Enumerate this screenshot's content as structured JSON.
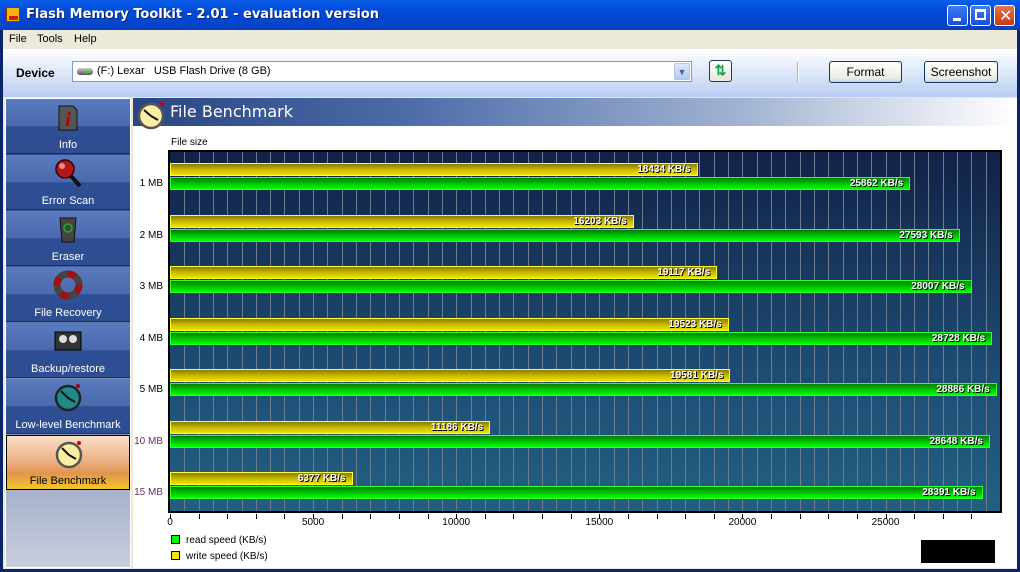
{
  "window": {
    "title": "Flash Memory Toolkit - 2.01 - evaluation version"
  },
  "menu": [
    "File",
    "Tools",
    "Help"
  ],
  "toolbar": {
    "device_label": "Device",
    "device_value": "(F:) Lexar   USB Flash Drive (8 GB)",
    "format_label": "Format",
    "screenshot_label": "Screenshot"
  },
  "sidebar": {
    "items": [
      {
        "label": "Info",
        "icon": "info-icon"
      },
      {
        "label": "Error Scan",
        "icon": "magnifier-icon"
      },
      {
        "label": "Eraser",
        "icon": "trash-icon"
      },
      {
        "label": "File Recovery",
        "icon": "lifebuoy-icon"
      },
      {
        "label": "Backup/restore",
        "icon": "tape-icon"
      },
      {
        "label": "Low-level Benchmark",
        "icon": "stopwatch-icon"
      },
      {
        "label": "File Benchmark",
        "icon": "stopwatch-icon",
        "active": true
      }
    ]
  },
  "panel": {
    "title": "File Benchmark",
    "ylabel": "File size"
  },
  "chart_data": {
    "type": "bar",
    "orientation": "horizontal",
    "title": "File Benchmark",
    "ylabel": "File size",
    "xlabel": "",
    "categories": [
      "1 MB",
      "2 MB",
      "3 MB",
      "4 MB",
      "5 MB",
      "10 MB",
      "15 MB"
    ],
    "series": [
      {
        "name": "write speed (KB/s)",
        "color": "#f0e400",
        "values": [
          18434,
          16203,
          19117,
          19523,
          19581,
          11186,
          6377
        ]
      },
      {
        "name": "read speed (KB/s)",
        "color": "#00ff00",
        "values": [
          25862,
          27593,
          28007,
          28728,
          28886,
          28648,
          28391
        ]
      }
    ],
    "value_suffix": " KB/s",
    "xlim": [
      0,
      29000
    ],
    "xticks": [
      0,
      5000,
      10000,
      15000,
      20000,
      25000
    ],
    "grid": true,
    "legend": [
      {
        "label": "read speed (KB/s)",
        "color": "#00ff00"
      },
      {
        "label": "write speed (KB/s)",
        "color": "#f0e400"
      }
    ],
    "legend_position": "bottom-left"
  }
}
